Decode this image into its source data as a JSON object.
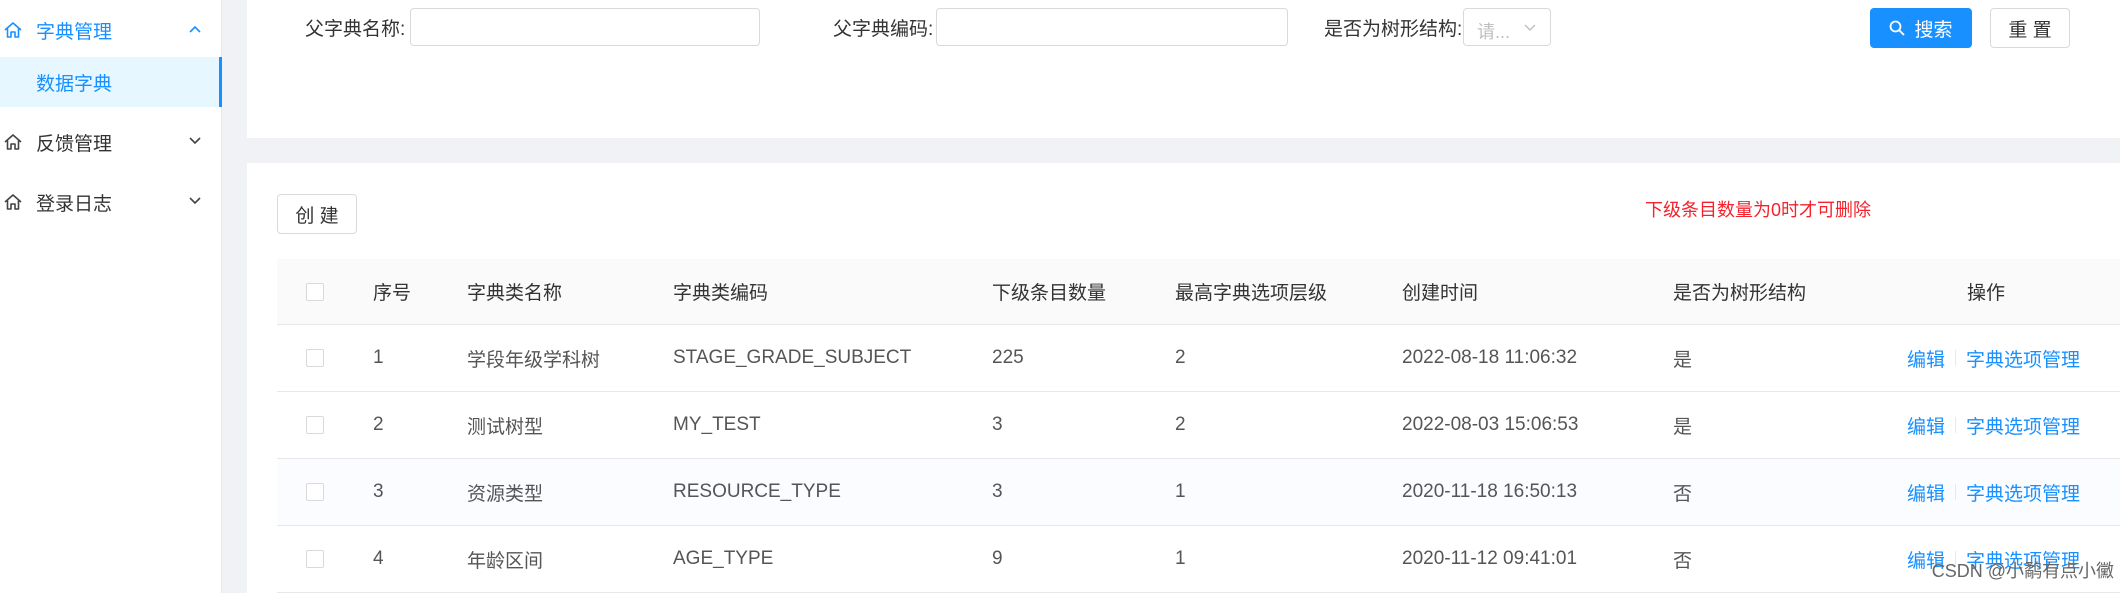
{
  "sidebar": {
    "dict_menu": {
      "label": "字典管理",
      "icon": "home-icon",
      "expanded": true
    },
    "dict_sub_item": {
      "label": "数据字典",
      "active": true
    },
    "feedback_menu": {
      "label": "反馈管理",
      "icon": "home-icon"
    },
    "log_menu": {
      "label": "登录日志",
      "icon": "home-icon"
    }
  },
  "search": {
    "parent_name_label": "父字典名称:",
    "parent_name_value": "",
    "parent_code_label": "父字典编码:",
    "parent_code_value": "",
    "is_tree_label": "是否为树形结构:",
    "is_tree_placeholder": "请...",
    "search_button": "搜索",
    "reset_button": "重 置"
  },
  "toolbar": {
    "create_button": "创 建",
    "delete_tip": "下级条目数量为0时才可删除"
  },
  "table": {
    "columns": [
      "序号",
      "字典类名称",
      "字典类编码",
      "下级条目数量",
      "最高字典选项层级",
      "创建时间",
      "是否为树形结构",
      "操作"
    ],
    "rows": [
      {
        "seq": "1",
        "name": "学段年级学科树",
        "code": "STAGE_GRADE_SUBJECT",
        "sub_count": "225",
        "max_level": "2",
        "created": "2022-08-18 11:06:32",
        "is_tree": "是",
        "edit": "编辑",
        "manage": "字典选项管理"
      },
      {
        "seq": "2",
        "name": "测试树型",
        "code": "MY_TEST",
        "sub_count": "3",
        "max_level": "2",
        "created": "2022-08-03 15:06:53",
        "is_tree": "是",
        "edit": "编辑",
        "manage": "字典选项管理"
      },
      {
        "seq": "3",
        "name": "资源类型",
        "code": "RESOURCE_TYPE",
        "sub_count": "3",
        "max_level": "1",
        "created": "2020-11-18 16:50:13",
        "is_tree": "否",
        "edit": "编辑",
        "manage": "字典选项管理"
      },
      {
        "seq": "4",
        "name": "年龄区间",
        "code": "AGE_TYPE",
        "sub_count": "9",
        "max_level": "1",
        "created": "2020-11-12 09:41:01",
        "is_tree": "否",
        "edit": "编辑",
        "manage": "字典选项管理"
      }
    ]
  },
  "watermark": "CSDN @小鹬有点小黴",
  "colors": {
    "primary": "#1890ff",
    "danger": "#f5222d",
    "active_bg": "#e6f7ff"
  }
}
